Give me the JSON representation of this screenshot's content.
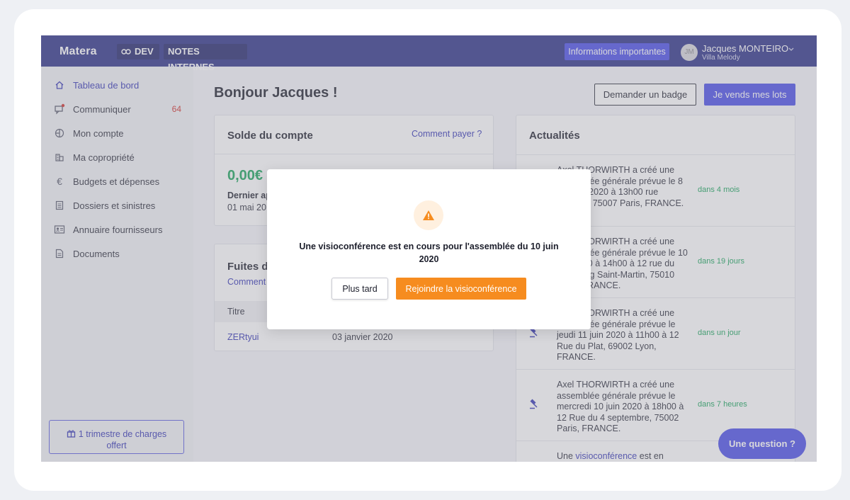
{
  "topbar": {
    "logo": "Matera",
    "env_tag": "DEV",
    "notes_tag": "NOTES INTERNES",
    "info_button": "Informations importantes",
    "user": {
      "initials": "JM",
      "name": "Jacques MONTEIRO",
      "residence": "Villa Melody"
    }
  },
  "sidebar": {
    "items": [
      {
        "label": "Tableau de bord",
        "icon": "home-icon"
      },
      {
        "label": "Communiquer",
        "icon": "chat-icon",
        "badge": "64"
      },
      {
        "label": "Mon compte",
        "icon": "account-icon"
      },
      {
        "label": "Ma copropriété",
        "icon": "building-icon"
      },
      {
        "label": "Budgets et dépenses",
        "icon": "euro-icon"
      },
      {
        "label": "Dossiers et sinistres",
        "icon": "folder-icon"
      },
      {
        "label": "Annuaire fournisseurs",
        "icon": "directory-icon"
      },
      {
        "label": "Documents",
        "icon": "document-icon"
      }
    ],
    "promo_line1": "1 trimestre de charges",
    "promo_line2": "offert"
  },
  "main": {
    "greeting": "Bonjour Jacques !",
    "badge_button": "Demander un badge",
    "sell_button": "Je vends mes lots",
    "balance_card": {
      "title": "Solde du compte",
      "link": "Comment payer ?",
      "amount": "0,00€",
      "last_label": "Dernier ap",
      "last_date": "01 mai 20"
    },
    "leaks_card": {
      "title": "Fuites d",
      "link": "Comment",
      "col_title": "Titre",
      "row_title": "ZERtyui",
      "row_date": "03 janvier 2020"
    },
    "news": {
      "title": "Actualités",
      "items": [
        {
          "text": "Axel THORWIRTH a créé une assemblée générale prévue le 8 octobre 2020 à 13h00 rue Oudinot, 75007 Paris, FRANCE.",
          "time": "dans 4 mois"
        },
        {
          "text": "Axel THORWIRTH a créé une assemblée générale prévue le 10 juin 2020 à 14h00 à 12 rue du Faubourg Saint-Martin, 75010 Paris, FRANCE.",
          "time": "dans 19 jours"
        },
        {
          "text": "Axel THORWIRTH a créé une assemblée générale prévue le jeudi 11 juin 2020 à 11h00 à 12 Rue du Plat, 69002 Lyon, FRANCE.",
          "time": "dans un jour"
        },
        {
          "text": "Axel THORWIRTH a créé une assemblée générale prévue le mercredi 10 juin 2020 à 18h00 à 12 Rue du 4 septembre, 75002 Paris, FRANCE.",
          "time": "dans 7 heures"
        }
      ],
      "last_prefix": "Une ",
      "last_link": "visioconférence",
      "last_suffix": " est en"
    },
    "question_button": "Une question ?"
  },
  "modal": {
    "message": "Une visioconférence est en cours pour l'assemblée du 10 juin 2020",
    "later_button": "Plus tard",
    "join_button": "Rejoindre la visioconférence"
  },
  "colors": {
    "topbar": "#2b2f86",
    "primary": "#4a4ce8",
    "orange": "#f68c1f",
    "green": "#17a35a",
    "badge_red": "#d0312d"
  }
}
